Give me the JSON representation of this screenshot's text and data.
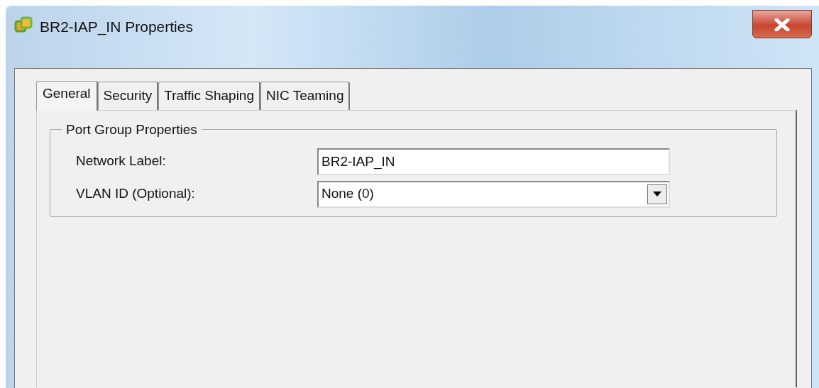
{
  "window": {
    "title": "BR2-IAP_IN Properties"
  },
  "tabs": [
    {
      "label": "General",
      "selected": true
    },
    {
      "label": "Security",
      "selected": false
    },
    {
      "label": "Traffic Shaping",
      "selected": false
    },
    {
      "label": "NIC Teaming",
      "selected": false
    }
  ],
  "group": {
    "title": "Port Group Properties",
    "fields": [
      {
        "kind": "text",
        "label": "Network Label:",
        "value": "BR2-IAP_IN"
      },
      {
        "kind": "dropdown",
        "label": "VLAN ID (Optional):",
        "value": "None (0)"
      }
    ]
  }
}
